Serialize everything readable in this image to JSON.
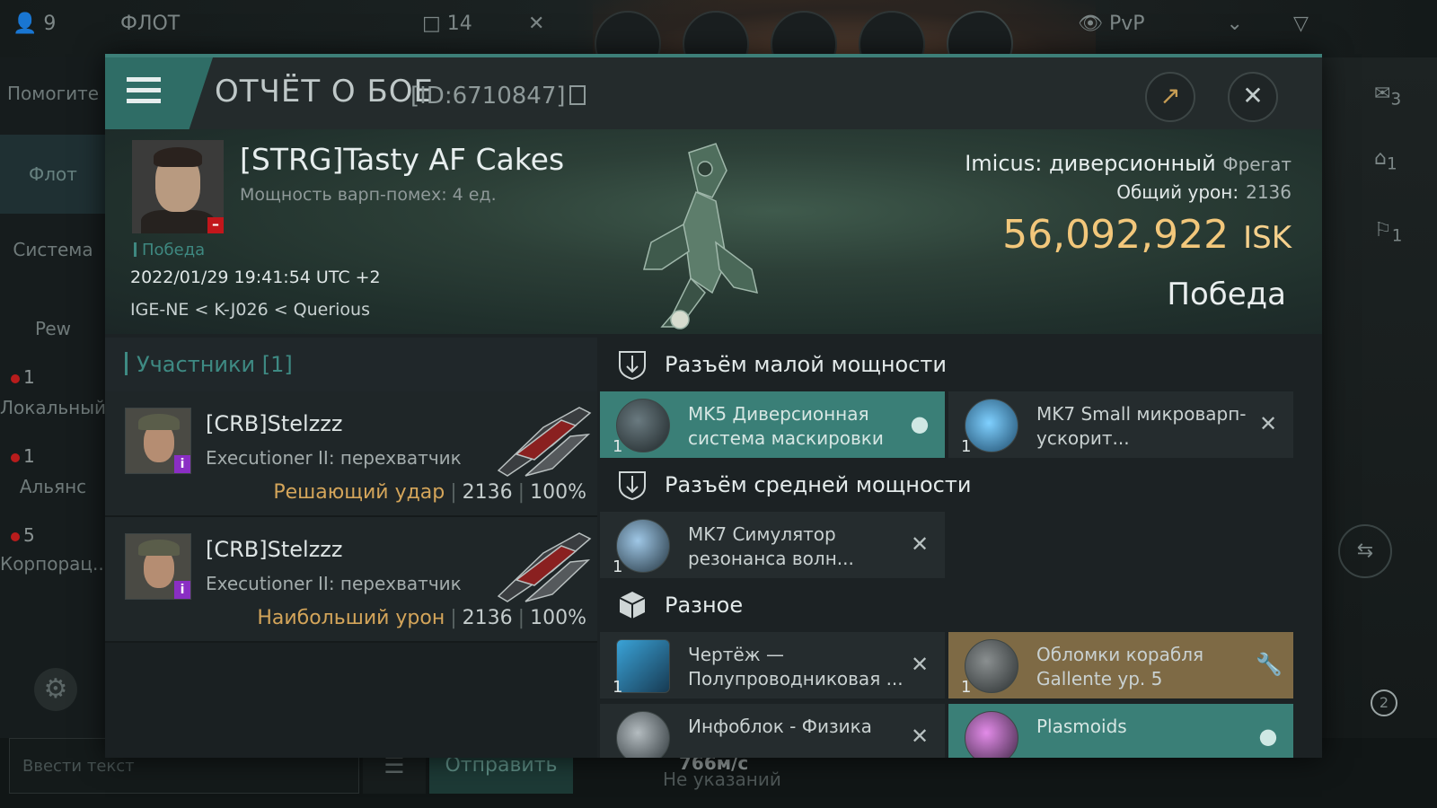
{
  "topbar": {
    "people_count": "9",
    "fleet_label": "ФЛОТ",
    "fleet_count": "14",
    "filter_mode": "PvP"
  },
  "left_nav": {
    "help": "Помогите",
    "fleet": "Флот",
    "system": "Система",
    "pew": "Pew",
    "local_count": "1",
    "local_label": "Локальный",
    "alliance_count": "1",
    "alliance_label": "Альянс",
    "corp_count": "5",
    "corp_label": "Корпорац..."
  },
  "right_nav": {
    "count_a": "3",
    "count_b": "1",
    "count_c": "1",
    "count_d": "2"
  },
  "chat": {
    "placeholder": "Ввести текст",
    "send_label": "Отправить",
    "speed": "766м/с",
    "no_info": "Не указаний"
  },
  "dialog": {
    "title": "ОТЧЁТ О БОЕ",
    "report_id": "[ID:6710847]",
    "victim": {
      "name": "[STRG]Tasty AF Cakes",
      "warp_disrupt": "Мощность варп-помех: 4 ед.",
      "tag": "Победа",
      "datetime": "2022/01/29 19:41:54 UTC +2",
      "location": "IGE-NE < K-J026 < Querious"
    },
    "ship_name": "Imicus: диверсионный",
    "ship_class": "Фрегат",
    "total_damage_label": "Общий урон:",
    "total_damage": "2136",
    "isk_value": "56,092,922",
    "isk_unit": "ISK",
    "result": "Победа"
  },
  "participants": {
    "header": "Участники [1]",
    "rows": [
      {
        "name": "[CRB]Stelzzz",
        "ship": "Executioner II: перехватчик",
        "role": "Решающий удар",
        "damage": "2136",
        "percent": "100%"
      },
      {
        "name": "[CRB]Stelzzz",
        "ship": "Executioner II: перехватчик",
        "role": "Наибольший урон",
        "damage": "2136",
        "percent": "100%"
      }
    ]
  },
  "modules": {
    "low_slot_title": "Разъём малой мощности",
    "mid_slot_title": "Разъём средней мощности",
    "misc_title": "Разное",
    "items": [
      {
        "name": "MK5 Диверсионная система маскировки",
        "qty": "1",
        "action": "person-icon",
        "state": "active"
      },
      {
        "name": "MK7 Small микроварп-ускорит...",
        "qty": "1",
        "action": "close-icon",
        "state": "normal"
      },
      {
        "name": "MK7 Симулятор резонанса волн...",
        "qty": "1",
        "action": "close-icon",
        "state": "normal"
      },
      {
        "name": "Чертёж — Полупроводниковая ...",
        "qty": "1",
        "action": "close-icon",
        "state": "normal"
      },
      {
        "name": "Обломки корабля Gallente ур. 5",
        "qty": "1",
        "action": "wrench-icon",
        "state": "gold"
      },
      {
        "name": "Инфоблок - Физика",
        "qty": "",
        "action": "close-icon",
        "state": "normal"
      },
      {
        "name": "Plasmoids",
        "qty": "",
        "action": "person-icon",
        "state": "active"
      }
    ]
  },
  "colors": {
    "accent": "#3d7f78",
    "isk_gold": "#f2c77b",
    "role_gold": "#d4a55a",
    "danger_red": "#c2161b",
    "badge_purple": "#8a2ec4"
  }
}
